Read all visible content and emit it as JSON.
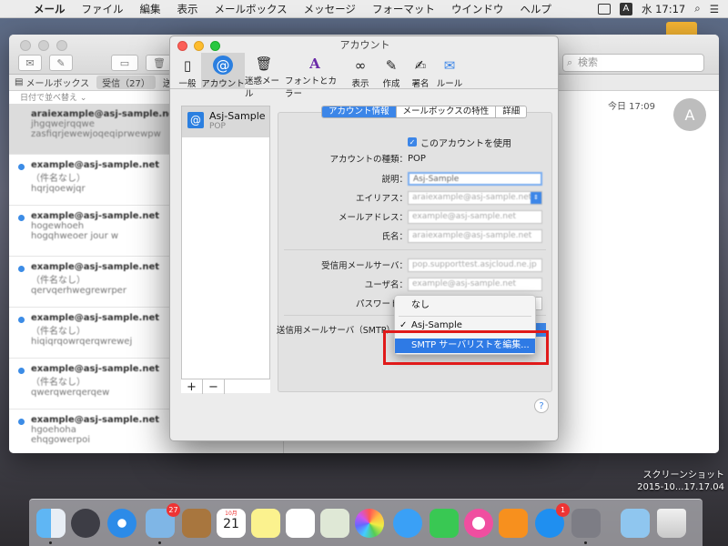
{
  "menubar": {
    "app": "メール",
    "items": [
      "ファイル",
      "編集",
      "表示",
      "メールボックス",
      "メッセージ",
      "フォーマット",
      "ウインドウ",
      "ヘルプ"
    ],
    "input_indicator": "A",
    "clock": "水 17:17"
  },
  "mail": {
    "search_placeholder": "検索",
    "favbar": {
      "mailboxes": "メールボックス",
      "inbox": "受信（27）",
      "sent": "送信済"
    },
    "sort_label": "日付で並べ替え",
    "date": "今日 17:09",
    "avatar": "A",
    "messages": [
      {
        "from": "araiexample@asj-sample.net",
        "subject": "jhgqwejrqqwe",
        "preview": "zasfiqrjewewjoqeqiprwewpw"
      },
      {
        "from": "example@asj-sample.net",
        "subject": "（件名なし）",
        "preview": "hqrjqoewjqr"
      },
      {
        "from": "example@asj-sample.net",
        "subject": "hogewhoeh",
        "preview": "hogqhweoer jour w"
      },
      {
        "from": "example@asj-sample.net",
        "subject": "（件名なし）",
        "preview": "qervqerhwegrewrper"
      },
      {
        "from": "example@asj-sample.net",
        "subject": "（件名なし）",
        "preview": "hiqiqrqowrqerqwrewej"
      },
      {
        "from": "example@asj-sample.net",
        "subject": "（件名なし）",
        "preview": "qwerqwerqerqew"
      },
      {
        "from": "example@asj-sample.net",
        "subject": "hgoehoha",
        "preview": "ehqgowerpoi"
      }
    ]
  },
  "prefs": {
    "title": "アカウント",
    "tabs": [
      "一般",
      "アカウント",
      "迷惑メール",
      "フォントとカラー",
      "表示",
      "作成",
      "署名",
      "ルール"
    ],
    "account": {
      "name": "Asj-Sample",
      "type": "POP"
    },
    "segments": [
      "アカウント情報",
      "メールボックスの特性",
      "詳細"
    ],
    "enable_label": "このアカウントを使用",
    "type_label": "アカウントの種類：",
    "type_value": "POP",
    "description_label": "説明：",
    "description_value": "Asj-Sample",
    "alias_label": "エイリアス：",
    "alias_value": "araiexample@asj-sample.net",
    "email_label": "メールアドレス：",
    "email_value": "example@asj-sample.net",
    "name_label": "氏名：",
    "name_value": "araiexample@asj-sample.net",
    "incoming_label": "受信用メールサーバ：",
    "incoming_value": "pop.supporttest.asjcloud.ne.jp",
    "username_label": "ユーザ名：",
    "username_value": "example@asj-sample.net",
    "password_label": "パスワード：",
    "outgoing_label": "送信用メールサーバ（SMTP）",
    "popup": {
      "none": "なし",
      "selected": "Asj-Sample",
      "edit": "SMTP サーバリストを編集...",
      "check": "✓"
    },
    "help": "?"
  },
  "desktop": {
    "screenshot_label_1": "スクリーンショット",
    "screenshot_label_2": "2015-10...17.17.04"
  },
  "dock": {
    "mail_badge": "27",
    "calendar_month": "10月",
    "calendar_day": "21",
    "appstore_badge": "1"
  },
  "colors": {
    "accent": "#2e7ae5",
    "highlight_box": "#e01a1a"
  }
}
